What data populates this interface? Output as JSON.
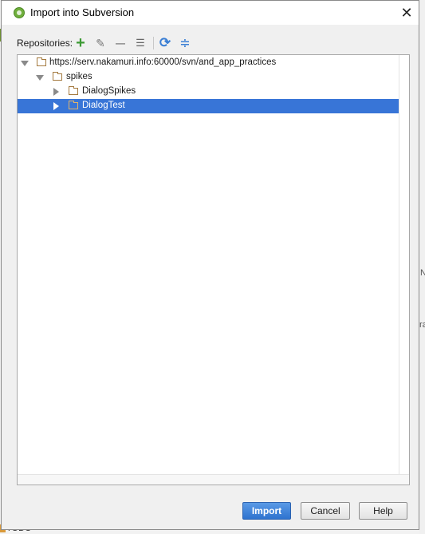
{
  "dialog": {
    "title": "Import into Subversion",
    "close_glyph": "✕"
  },
  "toolbar": {
    "label": "Repositories:",
    "buttons": [
      {
        "name": "add-icon",
        "glyph": "+",
        "color": "#3c9a34"
      },
      {
        "name": "edit-icon",
        "glyph": "✎",
        "color": "#777777"
      },
      {
        "name": "remove-icon",
        "glyph": "—",
        "color": "#777777"
      },
      {
        "name": "browse-icon",
        "glyph": "☰",
        "color": "#666666"
      },
      {
        "name": "refresh-icon",
        "glyph": "⟳",
        "color": "#3b7fd4"
      },
      {
        "name": "collapse-icon",
        "glyph": "≑",
        "color": "#3b7fd4"
      }
    ]
  },
  "tree": {
    "root": {
      "label": "https://serv.nakamuri.info:60000/svn/and_app_practices",
      "expanded": true
    },
    "spikes": {
      "label": "spikes",
      "expanded": true
    },
    "children": [
      {
        "label": "DialogSpikes",
        "selected": false,
        "expanded": false
      },
      {
        "label": "DialogTest",
        "selected": true,
        "expanded": false
      }
    ]
  },
  "buttons": {
    "import": "Import",
    "cancel": "Cancel",
    "help": "Help"
  },
  "background": {
    "frag1": "N",
    "frag2": "ra",
    "todo": "TODO"
  },
  "colors": {
    "selection": "#3875d7",
    "primary_button": "#2f73cf",
    "folder": "#a47a3f"
  }
}
